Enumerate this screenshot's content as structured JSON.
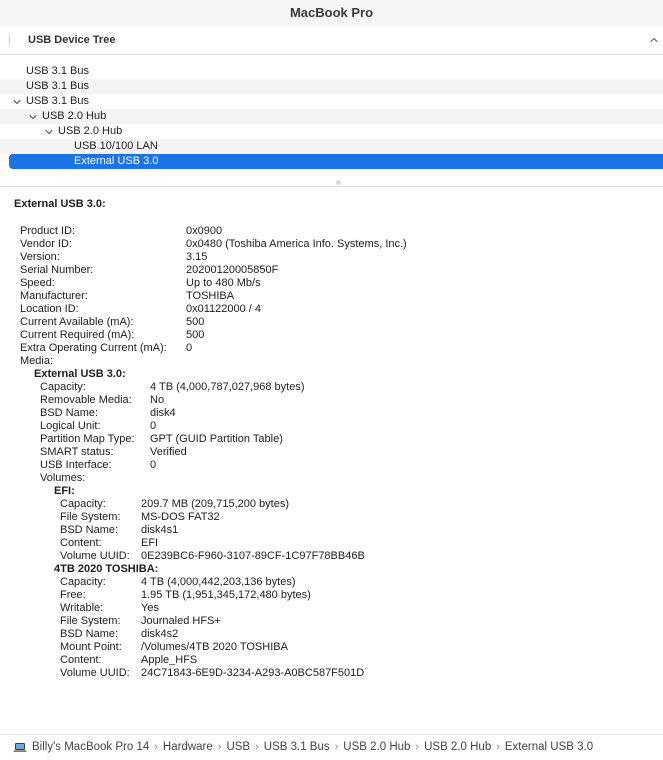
{
  "window": {
    "title": "MacBook Pro"
  },
  "tree_header": {
    "title": "USB Device Tree"
  },
  "tree": [
    {
      "label": "USB 3.1 Bus",
      "expanded": false
    },
    {
      "label": "USB 3.1 Bus",
      "expanded": false
    },
    {
      "label": "USB 3.1 Bus",
      "expanded": true
    },
    {
      "label": "USB 2.0 Hub",
      "expanded": true
    },
    {
      "label": "USB 2.0 Hub",
      "expanded": true
    },
    {
      "label": "USB 10/100 LAN",
      "expanded": false
    },
    {
      "label": "External USB 3.0",
      "expanded": false,
      "selected": true
    }
  ],
  "detail": {
    "title": "External USB 3.0:",
    "device": [
      {
        "key": "Product ID:",
        "value": "0x0900"
      },
      {
        "key": "Vendor ID:",
        "value": "0x0480  (Toshiba America Info. Systems, Inc.)"
      },
      {
        "key": "Version:",
        "value": "3.15"
      },
      {
        "key": "Serial Number:",
        "value": "20200120005850F"
      },
      {
        "key": "Speed:",
        "value": "Up to 480 Mb/s"
      },
      {
        "key": "Manufacturer:",
        "value": "TOSHIBA"
      },
      {
        "key": "Location ID:",
        "value": "0x01122000 / 4"
      },
      {
        "key": "Current Available (mA):",
        "value": "500"
      },
      {
        "key": "Current Required (mA):",
        "value": "500"
      },
      {
        "key": "Extra Operating Current (mA):",
        "value": "0"
      },
      {
        "key": "Media:",
        "value": ""
      }
    ],
    "media_heading": "External USB 3.0:",
    "media": [
      {
        "key": "Capacity:",
        "value": "4 TB (4,000,787,027,968 bytes)"
      },
      {
        "key": "Removable Media:",
        "value": "No"
      },
      {
        "key": "BSD Name:",
        "value": "disk4"
      },
      {
        "key": "Logical Unit:",
        "value": "0"
      },
      {
        "key": "Partition Map Type:",
        "value": "GPT (GUID Partition Table)"
      },
      {
        "key": "SMART status:",
        "value": "Verified"
      },
      {
        "key": "USB Interface:",
        "value": "0"
      },
      {
        "key": "Volumes:",
        "value": ""
      }
    ],
    "volumes": [
      {
        "heading": "EFI:",
        "fields": [
          {
            "key": "Capacity:",
            "value": "209.7 MB (209,715,200 bytes)"
          },
          {
            "key": "File System:",
            "value": "MS-DOS FAT32"
          },
          {
            "key": "BSD Name:",
            "value": "disk4s1"
          },
          {
            "key": "Content:",
            "value": "EFI"
          },
          {
            "key": "Volume UUID:",
            "value": "0E239BC6-F960-3107-89CF-1C97F78BB46B"
          }
        ]
      },
      {
        "heading": "4TB 2020 TOSHIBA:",
        "fields": [
          {
            "key": "Capacity:",
            "value": "4 TB (4,000,442,203,136 bytes)"
          },
          {
            "key": "Free:",
            "value": "1.95 TB (1,951,345,172,480 bytes)"
          },
          {
            "key": "Writable:",
            "value": "Yes"
          },
          {
            "key": "File System:",
            "value": "Journaled HFS+"
          },
          {
            "key": "BSD Name:",
            "value": "disk4s2"
          },
          {
            "key": "Mount Point:",
            "value": "/Volumes/4TB 2020 TOSHIBA"
          },
          {
            "key": "Content:",
            "value": "Apple_HFS"
          },
          {
            "key": "Volume UUID:",
            "value": "24C71843-6E9D-3234-A293-A0BC587F501D"
          }
        ]
      }
    ]
  },
  "breadcrumb": {
    "icon": "laptop-icon",
    "items": [
      "Billy's MacBook Pro 14",
      "Hardware",
      "USB",
      "USB 3.1 Bus",
      "USB 2.0 Hub",
      "USB 2.0 Hub",
      "External USB 3.0"
    ],
    "separator": "›"
  },
  "colors": {
    "selection": "#1a73e8",
    "alt_row": "#f4f4f5"
  }
}
